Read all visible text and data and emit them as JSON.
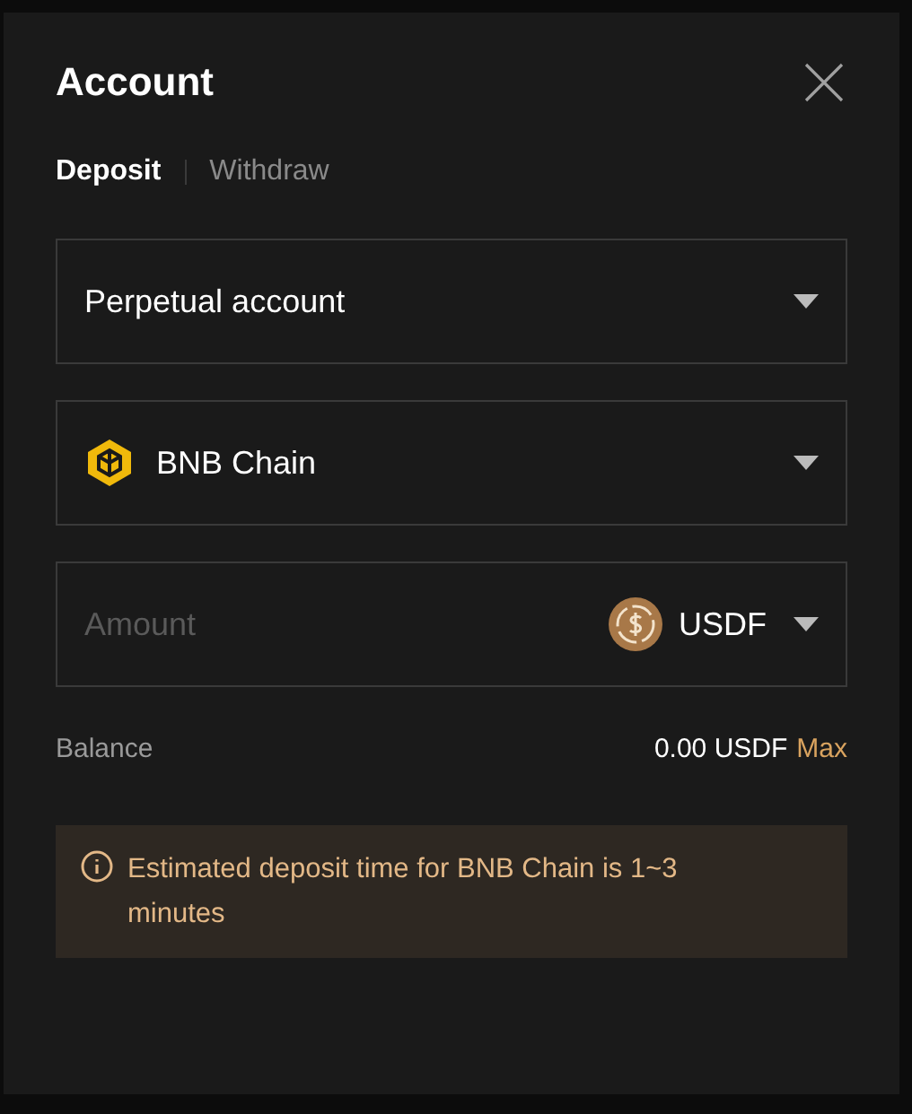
{
  "dialog": {
    "title": "Account"
  },
  "tabs": [
    {
      "label": "Deposit",
      "selected": true
    },
    {
      "label": "Withdraw",
      "selected": false
    }
  ],
  "account_select": {
    "value": "Perpetual account"
  },
  "network_select": {
    "value": "BNB Chain"
  },
  "amount": {
    "placeholder": "Amount",
    "token": "USDF"
  },
  "balance": {
    "label": "Balance",
    "value": "0.00 USDF",
    "action": "Max"
  },
  "notice": {
    "text": "Estimated deposit time for BNB Chain is 1~3 minutes"
  }
}
